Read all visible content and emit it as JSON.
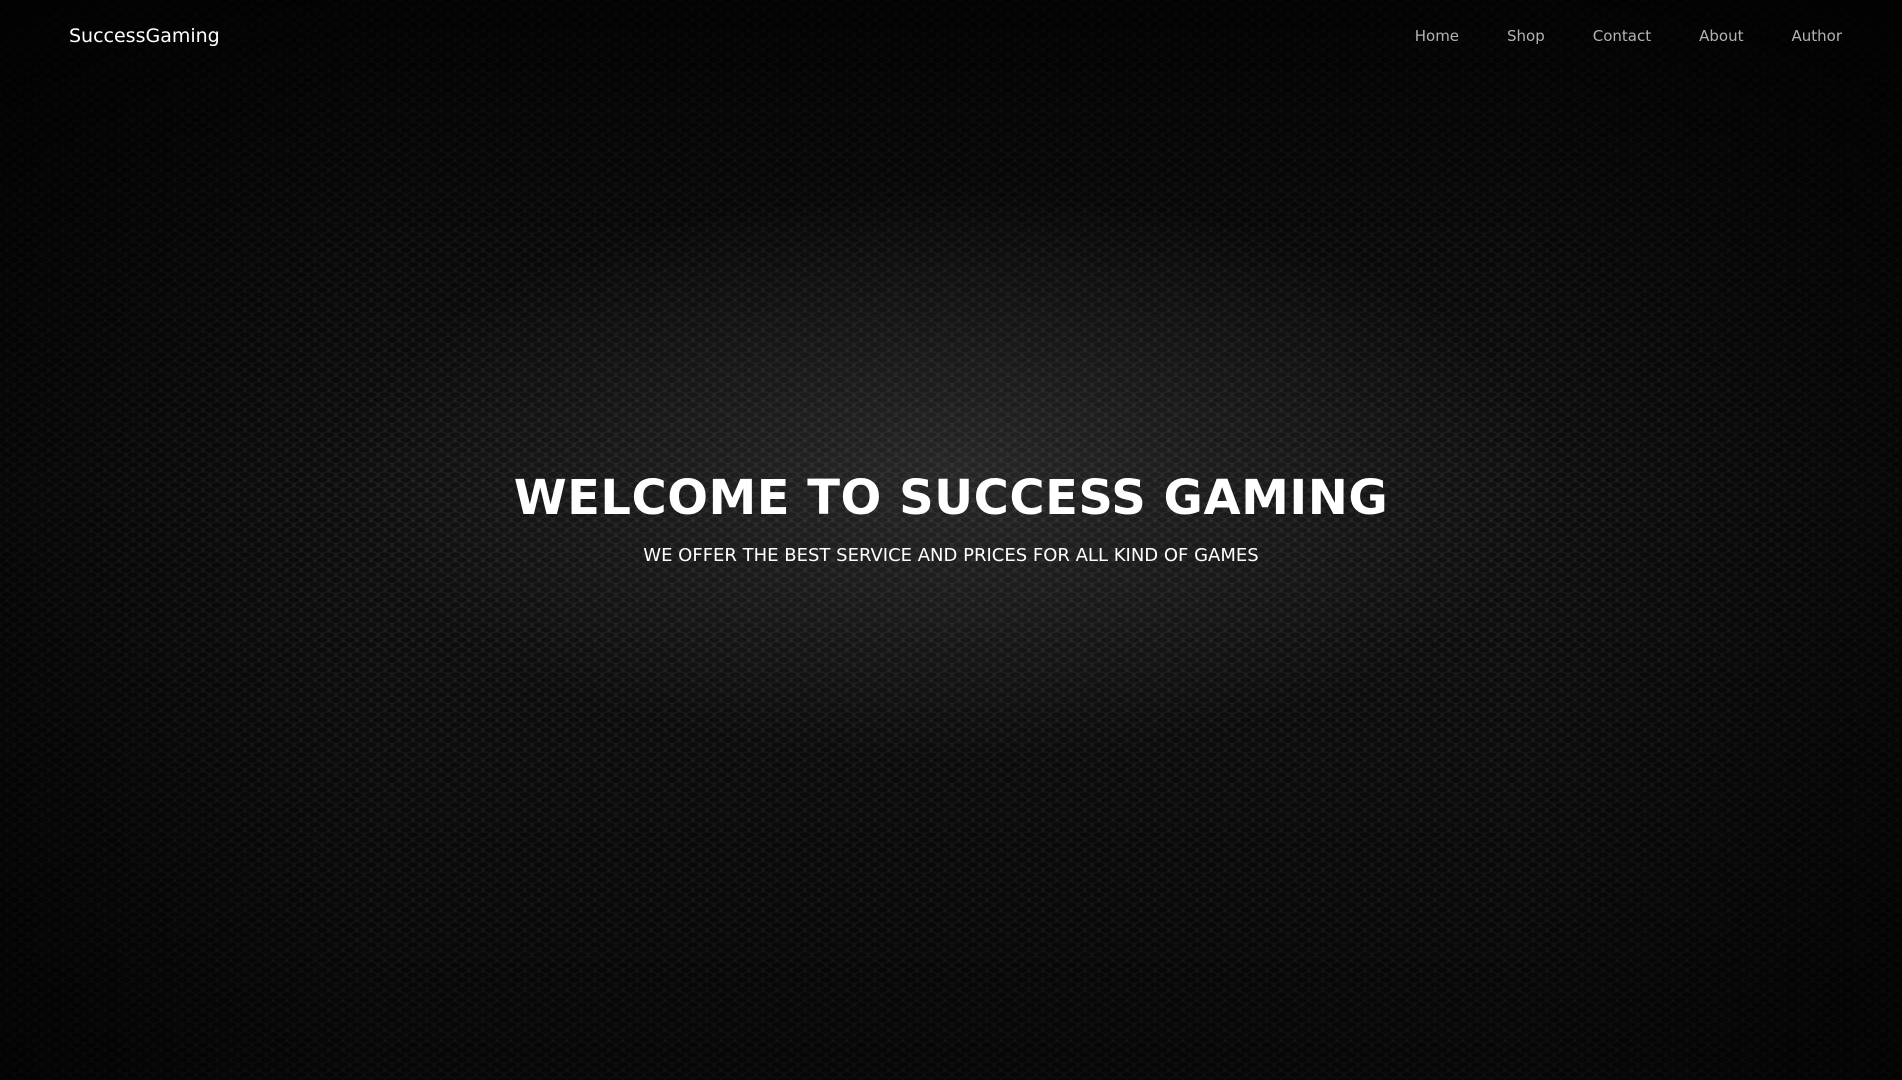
{
  "navbar": {
    "brand": "SuccessGaming",
    "links": [
      {
        "label": "Home"
      },
      {
        "label": "Shop"
      },
      {
        "label": "Contact"
      },
      {
        "label": "About"
      },
      {
        "label": "Author"
      }
    ]
  },
  "hero": {
    "title": "WELCOME TO SUCCESS GAMING",
    "subtitle": "WE OFFER THE BEST SERVICE AND PRICES FOR ALL KIND OF GAMES"
  },
  "colors": {
    "background": "#1f1f1f",
    "text": "#ffffff",
    "nav_link": "#b3b3b3"
  }
}
